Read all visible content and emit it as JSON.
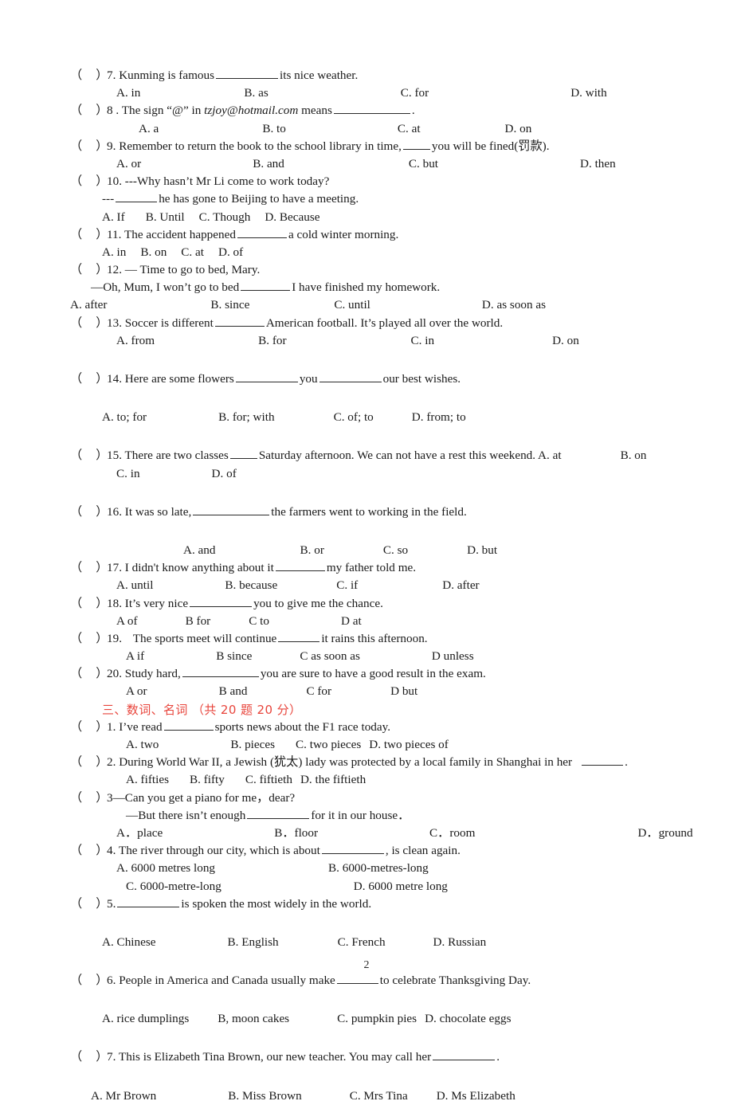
{
  "document": {
    "page_number": "2",
    "marker_open": "（",
    "marker_close": "）",
    "section_header": "三、数词、名词 （共 20 题 20 分）",
    "accent_color": "#e8453c",
    "text_color": "#1a1a1a"
  },
  "section_two_questions": [
    {
      "number": "7.",
      "stem_before": "Kunming is famous",
      "stem_after": "its nice weather.",
      "options": [
        "A. in",
        "B. as",
        "C. for",
        "D. with"
      ]
    },
    {
      "number": "8 .",
      "stem_before": "The sign “@” in",
      "stem_italic": "tzjoy@hotmail.com",
      "stem_mid": "means",
      "stem_after": ".",
      "options": [
        "A. a",
        "B. to",
        "C. at",
        "D. on"
      ]
    },
    {
      "number": "9.",
      "stem_before": "Remember to return the book to the school library in time,",
      "stem_after": "you will be fined(罚款).",
      "options": [
        "A. or",
        "B. and",
        "C. but",
        "D. then"
      ]
    },
    {
      "number": "10.",
      "stem_line1": "---Why hasn’t Mr Li come to work today?",
      "stem_line2_before": "---",
      "stem_line2_after": "he has gone to Beijing to have a meeting.",
      "options": [
        "A. If",
        "B. Until",
        "C. Though",
        "D. Because"
      ]
    },
    {
      "number": "11.",
      "stem_before": "The accident happened",
      "stem_after": "a cold winter morning.",
      "options": [
        "A. in",
        "B. on",
        "C. at",
        "D. of"
      ]
    },
    {
      "number": "12.",
      "stem_line1": "— Time to go to bed, Mary.",
      "stem_line2_before": "—Oh, Mum, I won’t go to bed",
      "stem_line2_after": "I have finished my homework.",
      "options": [
        "A. after",
        "B. since",
        "C. until",
        "D. as soon as"
      ]
    },
    {
      "number": "13.",
      "stem_before": "Soccer is different",
      "stem_after": "American football. It’s played all over the world.",
      "options": [
        "A. from",
        "B. for",
        "C. in",
        "D. on"
      ]
    },
    {
      "number": "14.",
      "stem_before": "Here are some flowers",
      "stem_mid": "you",
      "stem_after": "our best wishes.",
      "options": [
        "A. to; for",
        "B. for; with",
        "C. of; to",
        "D. from; to"
      ]
    },
    {
      "number": "15.",
      "stem_before": "There are two classes",
      "stem_after": "Saturday afternoon. We can not have a rest this weekend. A. at",
      "option_trailing": "B. on",
      "options": [
        "C. in",
        "D. of"
      ]
    },
    {
      "number": "16.",
      "stem_before": "It was so late,",
      "stem_after": "the farmers went to working in the field.",
      "options": [
        "A. and",
        "B. or",
        "C. so",
        "D. but"
      ]
    },
    {
      "number": "17.",
      "stem_before": "I didn't know anything about it",
      "stem_after": "my father told me.",
      "options": [
        "A. until",
        "B. because",
        "C. if",
        "D. after"
      ]
    },
    {
      "number": "18.",
      "stem_before": "It’s   very nice",
      "stem_after": "you to give me the chance.",
      "options": [
        "A of",
        "B for",
        "C to",
        "D at"
      ]
    },
    {
      "number": "19.",
      "stem_before": "The sports meet will continue",
      "stem_after": "it rains this afternoon.",
      "options": [
        "A if",
        "B since",
        "C as soon as",
        "D unless"
      ]
    },
    {
      "number": "20.",
      "stem_before": "Study hard,",
      "stem_after": "you are sure to have a good result in the exam.",
      "options": [
        "A or",
        "B and",
        "C for",
        "D but"
      ]
    }
  ],
  "section_three_questions": [
    {
      "number": "1.",
      "stem_before": "I’ve read",
      "stem_after": "sports news about the F1 race today.",
      "options": [
        "A. two",
        "B.  pieces",
        "C. two pieces",
        "D.   two pieces of"
      ]
    },
    {
      "number": "2.",
      "stem_before": "During World War II, a Jewish (犹太) lady was protected by a local family in Shanghai in her",
      "stem_after": ".",
      "options": [
        "A.  fifties",
        "B.   fifty",
        "C.   fiftieth",
        "D.   the fiftieth"
      ]
    },
    {
      "number": "3",
      "stem_line1": "—Can you get a piano for me，dear?",
      "stem_line2_before": "—But there isn’t enough",
      "stem_line2_after": "for it in our house．",
      "options": [
        "A．place",
        "B．floor",
        "C．room",
        "D．ground"
      ]
    },
    {
      "number": "4.",
      "stem_before": "The river through our city, which is about",
      "stem_after": ", is clean again.",
      "options": [
        "A. 6000   metres   long",
        "B. 6000-metres-long",
        "C. 6000-metre-long",
        "D. 6000 metre long"
      ]
    },
    {
      "number": "5.",
      "stem_before": "",
      "stem_after": "is spoken the most widely in the world.",
      "options": [
        "A. Chinese",
        "B. English",
        "C. French",
        "D. Russian"
      ]
    },
    {
      "number": "6.",
      "stem_before": "People in America and Canada usually make",
      "stem_after": "to celebrate Thanksgiving Day.",
      "options": [
        "A. rice dumplings",
        "B, moon cakes",
        "C. pumpkin pies",
        "D. chocolate eggs"
      ]
    },
    {
      "number": "7.",
      "stem_before": "This is Elizabeth Tina Brown, our new teacher. You may call her",
      "stem_after": ".",
      "options": [
        "A. Mr Brown",
        "B. Miss Brown",
        "C. Mrs Tina",
        "D. Ms Elizabeth"
      ]
    }
  ]
}
